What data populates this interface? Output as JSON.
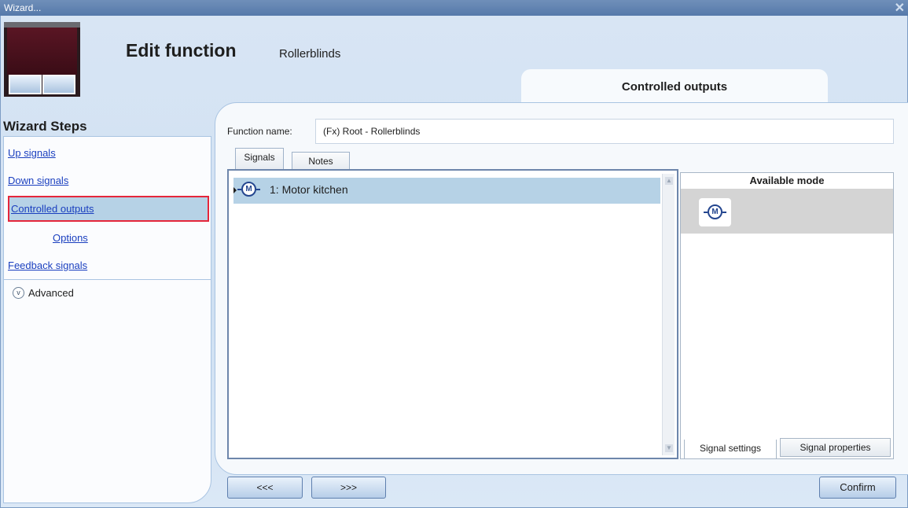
{
  "window": {
    "title": "Wizard...",
    "close_glyph": "✕"
  },
  "header": {
    "title": "Edit function",
    "subtitle": "Rollerblinds",
    "current_step": "Controlled outputs"
  },
  "sidebar": {
    "heading": "Wizard Steps",
    "items": [
      {
        "label": "Up signals"
      },
      {
        "label": "Down signals"
      },
      {
        "label": "Controlled outputs",
        "selected": true
      },
      {
        "label": "Options"
      },
      {
        "label": "Feedback signals"
      }
    ],
    "advanced_label": "Advanced"
  },
  "form": {
    "function_name_label": "Function name:",
    "function_name_value": "(Fx) Root - Rollerblinds"
  },
  "tabs": [
    {
      "label": "Signals",
      "active": true
    },
    {
      "label": "Notes"
    }
  ],
  "signals": {
    "items": [
      {
        "label": "1: Motor kitchen",
        "icon": "motor-icon"
      }
    ]
  },
  "available_mode": {
    "heading": "Available mode",
    "icon": "motor-icon",
    "icon_glyph": "M"
  },
  "bottom_tabs": [
    {
      "label": "Signal settings",
      "active": true
    },
    {
      "label": "Signal properties"
    }
  ],
  "buttons": {
    "prev": "<<<",
    "next": ">>>",
    "confirm": "Confirm"
  },
  "colors": {
    "selection": "#b6d2e6",
    "highlight_border": "#e5263b",
    "link": "#1a3fbf",
    "titlebar": "#5f81b0"
  }
}
